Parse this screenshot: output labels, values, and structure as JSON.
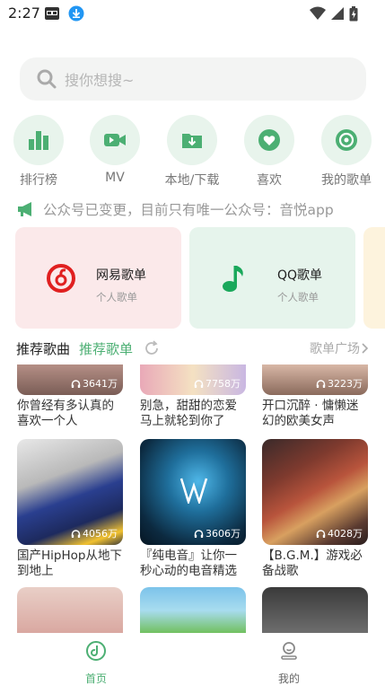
{
  "status_bar": {
    "time": "2:27"
  },
  "search": {
    "placeholder": "搜你想搜~"
  },
  "shortcuts": [
    {
      "label": "排行榜",
      "icon": "chart-icon"
    },
    {
      "label": "MV",
      "icon": "video-icon"
    },
    {
      "label": "本地/下载",
      "icon": "download-folder-icon"
    },
    {
      "label": "喜欢",
      "icon": "heart-icon"
    },
    {
      "label": "我的歌单",
      "icon": "disc-icon"
    }
  ],
  "notice": {
    "text": "公众号已变更，目前只有唯一公众号：音悦app"
  },
  "playlist_cards": [
    {
      "name": "网易歌单",
      "sub": "个人歌单",
      "bg": "#fbe9ea"
    },
    {
      "name": "QQ歌单",
      "sub": "个人歌单",
      "bg": "#e6f4ec"
    }
  ],
  "section": {
    "title_a": "推荐歌曲",
    "title_b": "推荐歌单",
    "more": "歌单广场"
  },
  "grid": [
    {
      "count": "3641万",
      "title": "你曾经有多认真的喜欢一个人"
    },
    {
      "count": "7758万",
      "title": "别急，甜甜的恋爱马上就轮到你了"
    },
    {
      "count": "3223万",
      "title": "开口沉醉 · 慵懒迷幻的欧美女声"
    },
    {
      "count": "4056万",
      "title": "国产HipHop从地下到地上"
    },
    {
      "count": "3606万",
      "title": "『纯电音』让你一秒心动的电音精选"
    },
    {
      "count": "4028万",
      "title": "【B.G.M.】游戏必备战歌"
    }
  ],
  "bottom_nav": [
    {
      "label": "首页"
    },
    {
      "label": "我的"
    }
  ],
  "colors": {
    "accent": "#4caf73",
    "shortcut_bg": "#e8f4ec"
  }
}
